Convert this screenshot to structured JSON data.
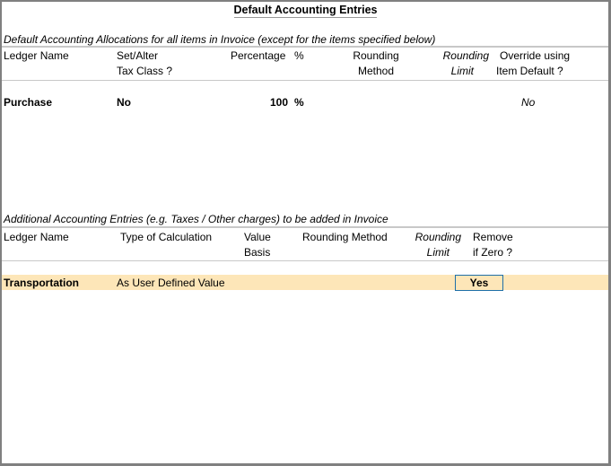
{
  "title": "Default Accounting Entries",
  "default_section": {
    "caption": "Default Accounting Allocations for all items in Invoice (except for the items specified below)",
    "headers": {
      "ledger_name": "Ledger Name",
      "set_alter_1": "Set/Alter",
      "set_alter_2": "Tax Class ?",
      "percentage": "Percentage",
      "percent_sign": "%",
      "rounding_method_1": "Rounding",
      "rounding_method_2": "Method",
      "rounding_limit_1": "Rounding",
      "rounding_limit_2": "Limit",
      "override_1": "Override using",
      "override_2": "Item Default ?"
    },
    "rows": [
      {
        "ledger_name": "Purchase",
        "set_alter_tax_class": "No",
        "percentage": "100",
        "percent_sign": "%",
        "rounding_method": "",
        "rounding_limit": "",
        "override_item_default": "No"
      }
    ]
  },
  "additional_section": {
    "caption": "Additional Accounting Entries (e.g. Taxes / Other charges) to be added in Invoice",
    "headers": {
      "ledger_name": "Ledger Name",
      "type_of_calculation": "Type of Calculation",
      "value_basis_1": "Value",
      "value_basis_2": "Basis",
      "rounding_method": "Rounding Method",
      "rounding_limit_1": "Rounding",
      "rounding_limit_2": "Limit",
      "remove_if_zero_1": "Remove",
      "remove_if_zero_2": "if Zero ?"
    },
    "rows": [
      {
        "ledger_name": "Transportation",
        "type_of_calculation": "As User Defined Value",
        "value_basis": "",
        "rounding_method": "",
        "rounding_limit": "",
        "remove_if_zero": "Yes"
      }
    ]
  },
  "colors": {
    "highlight_row": "#fde6b8",
    "focus_border": "#1f6fa8",
    "frame_border": "#808080",
    "separator": "#c8c8c8"
  }
}
